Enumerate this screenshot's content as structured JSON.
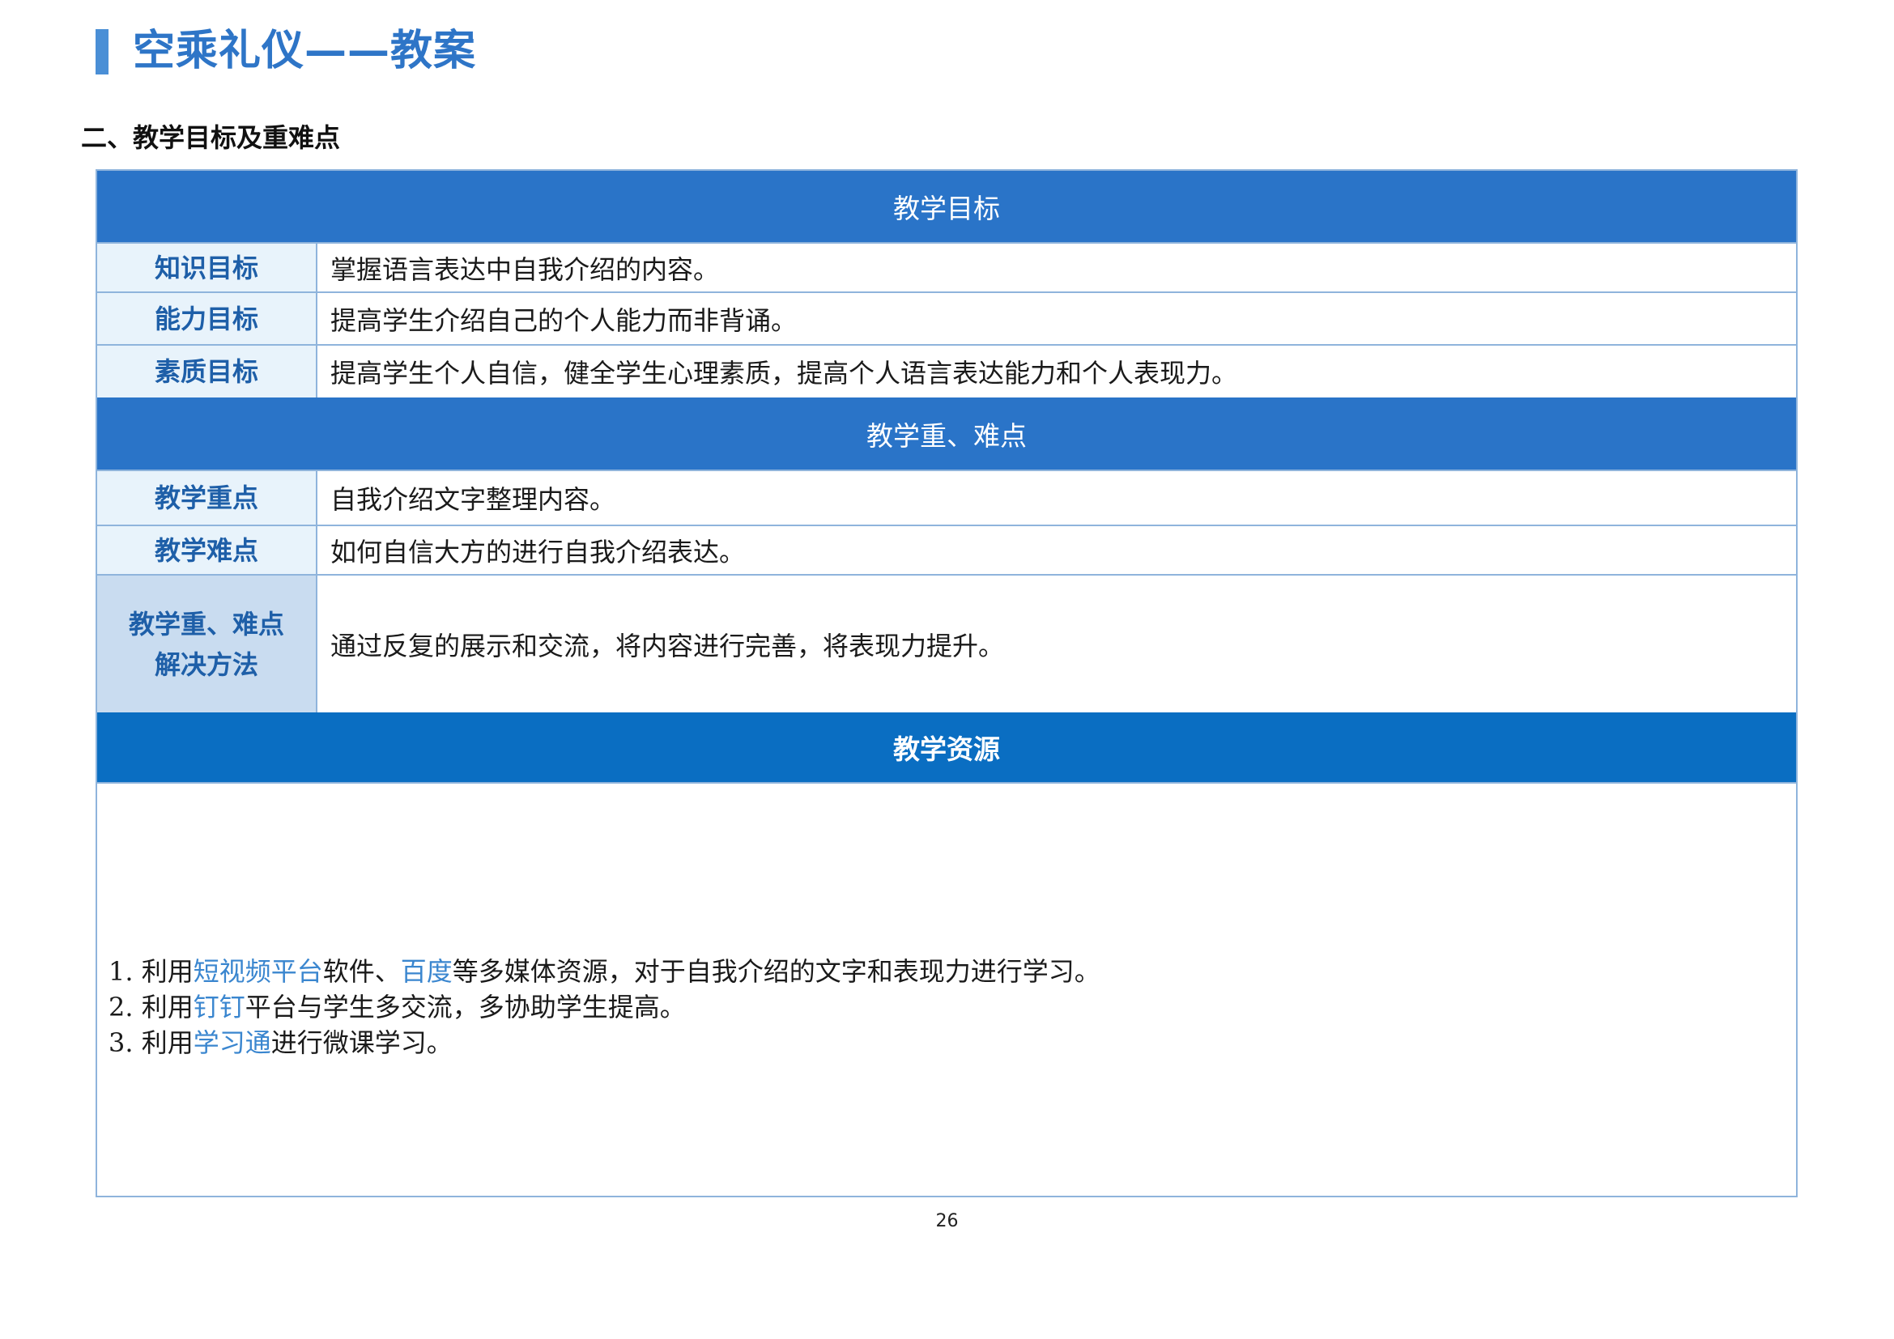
{
  "document": {
    "title": "空乘礼仪——教案",
    "section_heading": "二、教学目标及重难点",
    "page_number": "26"
  },
  "objectives": {
    "header": "教学目标",
    "rows": [
      {
        "label": "知识目标",
        "value": "掌握语言表达中自我介绍的内容。"
      },
      {
        "label": "能力目标",
        "value": "提高学生介绍自己的个人能力而非背诵。"
      },
      {
        "label": "素质目标",
        "value": "提高学生个人自信，健全学生心理素质，提高个人语言表达能力和个人表现力。"
      }
    ]
  },
  "key_points": {
    "header": "教学重、难点",
    "rows": [
      {
        "label": "教学重点",
        "value": "自我介绍文字整理内容。"
      },
      {
        "label": "教学难点",
        "value": "如何自信大方的进行自我介绍表达。"
      }
    ],
    "method": {
      "label_line1": "教学重、难点",
      "label_line2": "解决方法",
      "value": "通过反复的展示和交流，将内容进行完善，将表现力提升。"
    }
  },
  "resources": {
    "header": "教学资源",
    "items": [
      {
        "prefix": "1. 利用",
        "highlight1": "短视频平台",
        "middle": "软件、",
        "highlight2": "百度",
        "suffix": "等多媒体资源，对于自我介绍的文字和表现力进行学习。"
      },
      {
        "prefix": "2. 利用",
        "highlight1": "钉钉",
        "suffix": "平台与学生多交流，多协助学生提高。"
      },
      {
        "prefix": "3. 利用",
        "highlight1": "学习通",
        "suffix": "进行微课学习。"
      }
    ]
  },
  "colors": {
    "title_blue": "#2e75c7",
    "band_blue": "#2a74c8",
    "band_dark_blue": "#0a6ec2",
    "label_bg": "#e8f3fb",
    "label_text": "#1e5fa8",
    "highlight_text": "#3a86cf",
    "border": "#8fb4dc"
  }
}
